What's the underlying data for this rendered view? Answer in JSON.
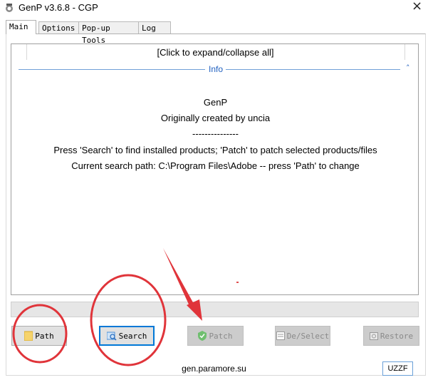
{
  "window": {
    "title": "GenP v3.6.8 - CGP",
    "close_glyph": "×"
  },
  "tabs": [
    {
      "label": "Main",
      "active": true
    },
    {
      "label": "Options",
      "active": false
    },
    {
      "label": "Pop-up Tools",
      "active": false
    },
    {
      "label": "Log",
      "active": false
    }
  ],
  "info_panel": {
    "expand_link": "[Click to expand/collapse all]",
    "section_label": "Info",
    "collapse_glyph": "˄",
    "lines": [
      "GenP",
      "Originally created by uncia",
      "---------------",
      "Press 'Search' to find installed products; 'Patch' to patch selected products/files",
      "Current search path: C:\\Program Files\\Adobe -- press 'Path' to change"
    ]
  },
  "progress": {
    "value": 0
  },
  "buttons": {
    "path": {
      "label": "Path",
      "icon": "folder-icon",
      "enabled": true
    },
    "search": {
      "label": "Search",
      "icon": "search-icon",
      "enabled": true,
      "focused": true
    },
    "patch": {
      "label": "Patch",
      "icon": "shield-check-icon",
      "enabled": false
    },
    "deselect": {
      "label": "De/Select",
      "icon": "checklist-icon",
      "enabled": false
    },
    "restore": {
      "label": "Restore",
      "icon": "restore-icon",
      "enabled": false
    }
  },
  "footer": {
    "link": "gen.paramore.su"
  },
  "watermark": {
    "text": "UZZF"
  },
  "colors": {
    "accent": "#0078d7",
    "info_blue": "#1f5fbf",
    "annotation_red": "#e0343a"
  }
}
